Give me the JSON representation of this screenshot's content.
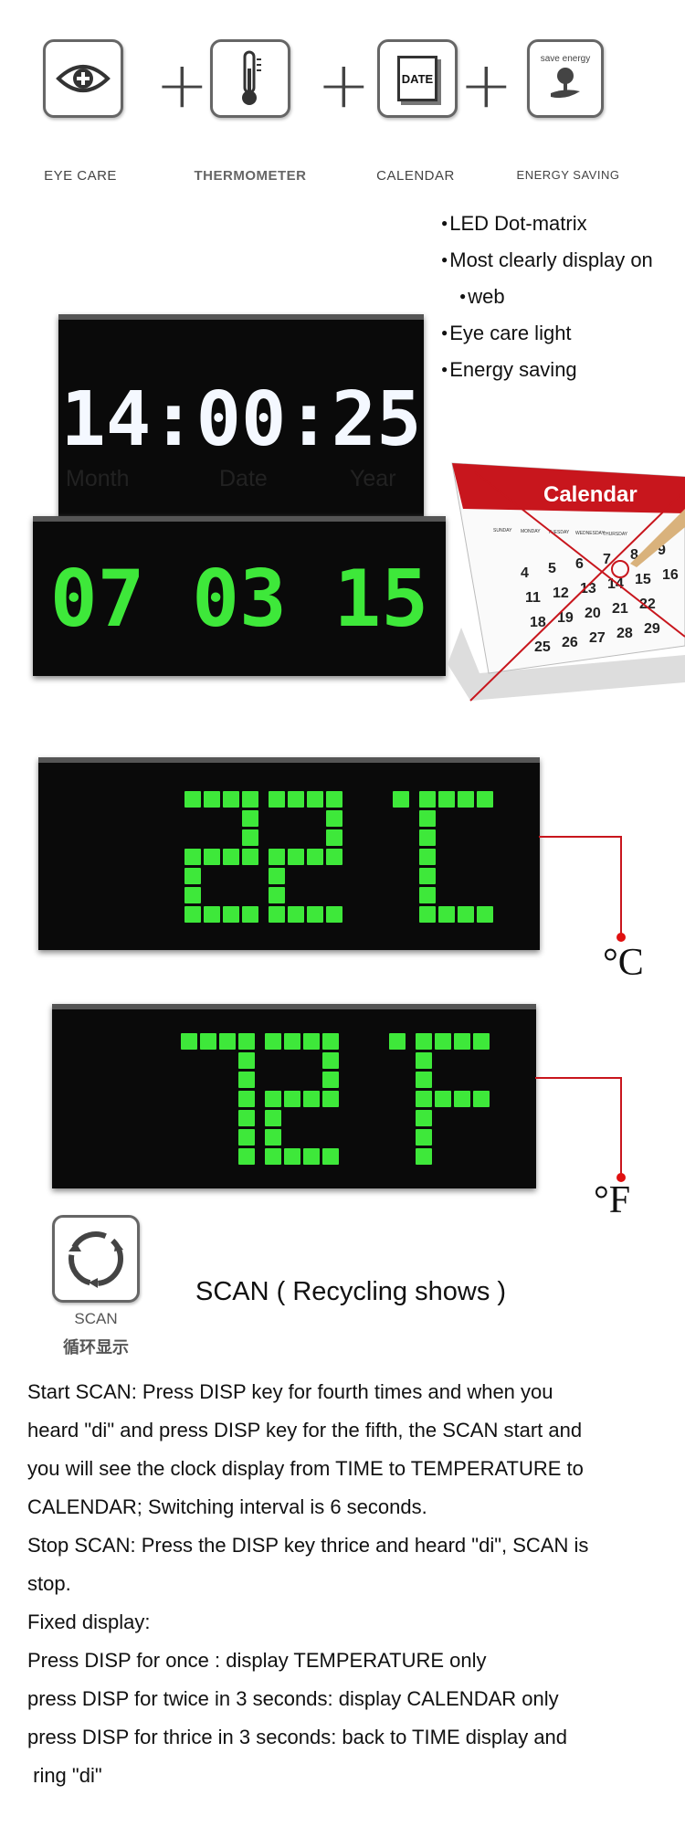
{
  "features": [
    {
      "icon": "eye-care-icon",
      "label": "EYE CARE"
    },
    {
      "icon": "thermometer-icon",
      "label": "THERMOMETER"
    },
    {
      "icon": "calendar-date-icon",
      "label": "CALENDAR",
      "icon_text": "DATE"
    },
    {
      "icon": "save-energy-icon",
      "label": "ENERGY SAVING",
      "icon_text": "save energy"
    }
  ],
  "plus": "+",
  "time_display": {
    "value": "14:00:25",
    "color": "#f4f8ff"
  },
  "bullets": [
    "LED Dot-matrix",
    "Most clearly display on",
    "web",
    "Eye care light",
    "Energy saving"
  ],
  "date_labels": {
    "month": "Month",
    "date": "Date",
    "year": "Year"
  },
  "date_display": {
    "value": "07 03 15",
    "color": "#3ee83a"
  },
  "calendar_image": {
    "title": "Calendar",
    "weekdays": [
      "SUNDAY",
      "MONDAY",
      "TUESDAY",
      "WEDNESDAY",
      "THURSDAY"
    ],
    "rows": [
      [
        "4",
        "5",
        "6",
        "7",
        "8",
        "9"
      ],
      [
        "11",
        "12",
        "13",
        "14",
        "15",
        "16"
      ],
      [
        "18",
        "19",
        "20",
        "21",
        "22"
      ],
      [
        "25",
        "26",
        "27",
        "28",
        "29"
      ]
    ],
    "accent": "#c8161d"
  },
  "temp_c": {
    "value": "22",
    "unit": "°C"
  },
  "temp_f": {
    "value": "72",
    "unit": "°F"
  },
  "scan": {
    "icon": "scan-cycle-icon",
    "label": "SCAN",
    "label_cn": "循环显示",
    "title": "SCAN ( Recycling shows )"
  },
  "instructions": [
    "Start SCAN: Press DISP key for fourth times and when you",
    "heard \"di\" and press DISP key for the fifth, the SCAN start and",
    "you will see the clock display from TIME to TEMPERATURE to",
    "CALENDAR; Switching interval is 6 seconds.",
    "Stop SCAN: Press the DISP key thrice and heard \"di\", SCAN is",
    "stop.",
    "Fixed display:",
    "Press DISP for once : display TEMPERATURE only",
    "press DISP for twice in 3 seconds: display CALENDAR only",
    "press DISP for thrice in 3 seconds: back to TIME display and",
    " ring \"di\""
  ]
}
